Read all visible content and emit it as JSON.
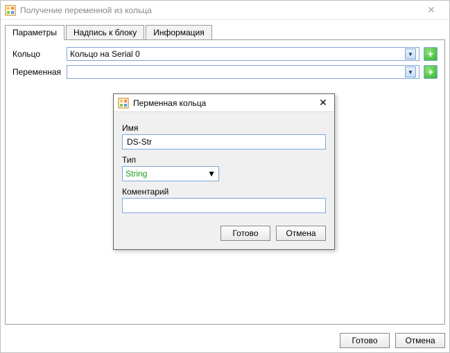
{
  "window": {
    "title": "Получение переменной из кольца"
  },
  "tabs": {
    "items": [
      {
        "label": "Параметры"
      },
      {
        "label": "Надпись к блоку"
      },
      {
        "label": "Информация"
      }
    ],
    "active": 0
  },
  "form": {
    "ring_label": "Кольцо",
    "ring_value": "Кольцо  на Serial 0",
    "var_label": "Переменная",
    "var_value": ""
  },
  "footer": {
    "done": "Готово",
    "cancel": "Отмена"
  },
  "dialog": {
    "title": "Перменная кольца",
    "name_label": "Имя",
    "name_value": "DS-Str",
    "type_label": "Тип",
    "type_value": "String",
    "comment_label": "Коментарий",
    "comment_value": "",
    "done": "Готово",
    "cancel": "Отмена"
  },
  "icons": {
    "app": "app-icon",
    "close": "close-icon",
    "dropdown": "chevron-down-icon",
    "add": "plus-icon"
  }
}
